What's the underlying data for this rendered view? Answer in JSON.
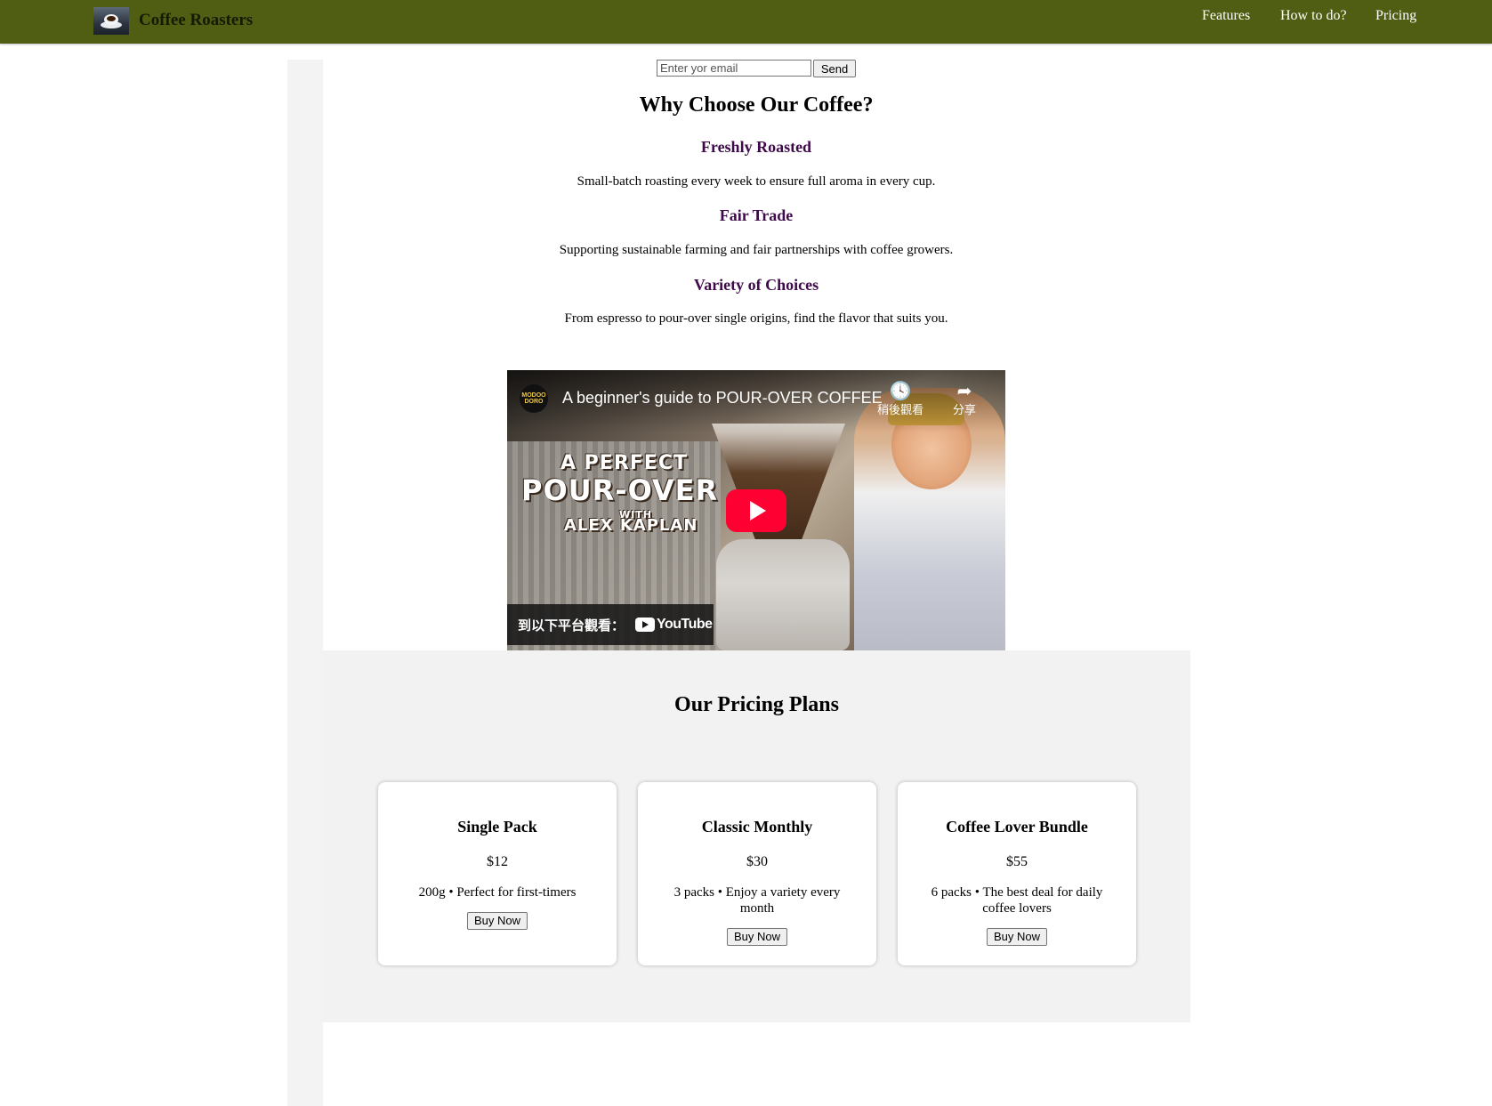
{
  "header": {
    "brand": "Coffee Roasters",
    "nav": [
      "Features",
      "How to do?",
      "Pricing"
    ],
    "bg_color": "#4f5e13"
  },
  "email_form": {
    "placeholder": "Enter yor email",
    "send_label": "Send"
  },
  "why": {
    "heading": "Why Choose Our Coffee?",
    "features": [
      {
        "title": "Freshly Roasted",
        "desc": "Small-batch roasting every week to ensure full aroma in every cup."
      },
      {
        "title": "Fair Trade",
        "desc": "Supporting sustainable farming and fair partnerships with coffee growers."
      },
      {
        "title": "Variety of Choices",
        "desc": "From espresso to pour-over single origins, find the flavor that suits you."
      }
    ]
  },
  "video": {
    "channel_badge": "MODOO DORO",
    "title": "A beginner's guide to POUR-OVER COFFEE",
    "watch_later": "稍後觀看",
    "share": "分享",
    "overlay_line1": "A PERFECT",
    "overlay_line2": "POUR-OVER",
    "overlay_line3": "WITH",
    "overlay_line4": "ALEX KAPLAN",
    "watch_on": "到以下平台觀看：",
    "youtube": "YouTube"
  },
  "pricing": {
    "heading": "Our Pricing Plans",
    "plans": [
      {
        "name": "Single Pack",
        "price": "$12",
        "desc": "200g • Perfect for first-timers",
        "cta": "Buy Now"
      },
      {
        "name": "Classic Monthly",
        "price": "$30",
        "desc": "3 packs • Enjoy a variety every month",
        "cta": "Buy Now"
      },
      {
        "name": "Coffee Lover Bundle",
        "price": "$55",
        "desc": "6 packs • The best deal for daily coffee lovers",
        "cta": "Buy Now"
      }
    ]
  }
}
